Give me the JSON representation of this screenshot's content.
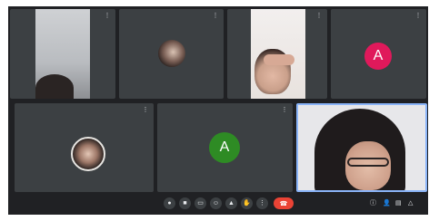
{
  "colors": {
    "background": "#202124",
    "tile": "#3c4043",
    "avatar_pink": "#e0195b",
    "avatar_green": "#2e8b24",
    "end_call": "#ea4335",
    "active_speaker_border": "#8ab4f8"
  },
  "tiles": [
    {
      "name": "",
      "more_icon": "more-vert-icon"
    },
    {
      "name": "",
      "more_icon": "more-vert-icon"
    },
    {
      "name": "",
      "more_icon": "more-vert-icon"
    },
    {
      "name": "",
      "more_icon": "more-vert-icon",
      "avatar_letter": "A"
    },
    {
      "name": "",
      "more_icon": "more-vert-icon"
    },
    {
      "name": "",
      "more_icon": "more-vert-icon",
      "avatar_letter": "A"
    },
    {
      "name": ""
    }
  ],
  "bottom_bar": {
    "meeting_info": ""
  }
}
